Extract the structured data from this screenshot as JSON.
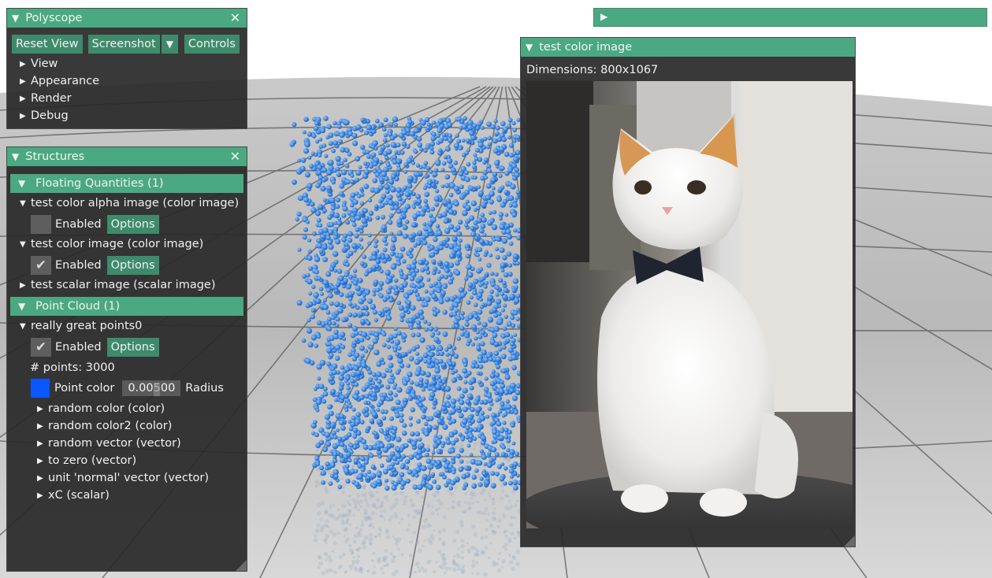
{
  "polyscope": {
    "title": "Polyscope",
    "buttons": {
      "reset": "Reset View",
      "screenshot": "Screenshot",
      "controls": "Controls"
    },
    "sections": [
      "View",
      "Appearance",
      "Render",
      "Debug"
    ]
  },
  "collapsed_window": {},
  "structures": {
    "title": "Structures",
    "floating_header": "Floating Quantities (1)",
    "alpha_image": {
      "label": "test color alpha image (color image)",
      "enabled": "Enabled",
      "options": "Options"
    },
    "color_image": {
      "label": "test color image (color image)",
      "enabled": "Enabled",
      "options": "Options"
    },
    "scalar_image": {
      "label": "test scalar image (scalar image)"
    },
    "pointcloud_header": "Point Cloud (1)",
    "points": {
      "label": "really great points0",
      "enabled": "Enabled",
      "options": "Options",
      "count": "# points: 3000",
      "color_label": "Point color",
      "color": "#0a57ff",
      "radius_value": "0.00500",
      "radius_label": "Radius",
      "quantities": [
        "random color (color)",
        "random color2 (color)",
        "random vector (vector)",
        "to zero (vector)",
        "unit 'normal' vector (vector)",
        "xC (scalar)"
      ]
    }
  },
  "image_window": {
    "title": "test color image",
    "dimensions": "Dimensions: 800x1067"
  },
  "colors": {
    "accent": "#4aa982",
    "button": "#3e8b6b",
    "points": "#3d86df",
    "window_bg": "#282828"
  }
}
